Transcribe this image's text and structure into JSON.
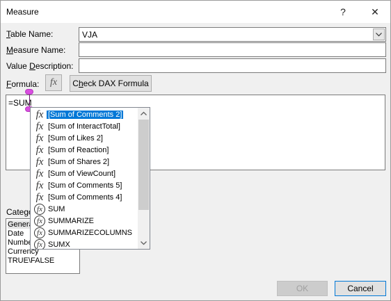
{
  "title_bar": {
    "title": "Measure",
    "help_label": "?",
    "close_label": "✕"
  },
  "form": {
    "table_name": {
      "label_u": "T",
      "label_rest": "able Name:",
      "value": "VJA"
    },
    "measure_name": {
      "label_u": "M",
      "label_rest": "easure Name:",
      "value": ""
    },
    "value_description": {
      "label_pre": "Value ",
      "label_u": "D",
      "label_rest": "escription:",
      "value": ""
    },
    "formula": {
      "label_u": "F",
      "label_rest": "ormula:",
      "value": "=SUM"
    },
    "fx_label": "fx",
    "check_dax": {
      "label_pre": "C",
      "label_u": "h",
      "label_rest": "eck DAX Formula"
    }
  },
  "category": {
    "label": "Catego",
    "items": [
      "General",
      "Date",
      "Number",
      "Currency",
      "TRUE\\FALSE"
    ]
  },
  "autocomplete": {
    "items": [
      {
        "label": "[Sum of Comments 2]",
        "icon": "fx-italic-icon",
        "selected": true
      },
      {
        "label": "[Sum of InteractTotal]",
        "icon": "fx-italic-icon"
      },
      {
        "label": "[Sum of Likes 2]",
        "icon": "fx-italic-icon"
      },
      {
        "label": "[Sum of Reaction]",
        "icon": "fx-italic-icon"
      },
      {
        "label": "[Sum of Shares 2]",
        "icon": "fx-italic-icon"
      },
      {
        "label": "[Sum of ViewCount]",
        "icon": "fx-italic-icon"
      },
      {
        "label": "[Sum of Comments 5]",
        "icon": "fx-italic-icon"
      },
      {
        "label": "[Sum of Comments 4]",
        "icon": "fx-italic-icon"
      },
      {
        "label": "SUM",
        "icon": "fx-circle-icon"
      },
      {
        "label": "SUMMARIZE",
        "icon": "fx-circle-icon"
      },
      {
        "label": "SUMMARIZECOLUMNS",
        "icon": "fx-circle-icon"
      },
      {
        "label": "SUMX",
        "icon": "fx-circle-icon"
      }
    ]
  },
  "buttons": {
    "ok": "OK",
    "cancel": "Cancel"
  },
  "colors": {
    "selection": "#0078d7",
    "handle": "#d94ee0"
  }
}
